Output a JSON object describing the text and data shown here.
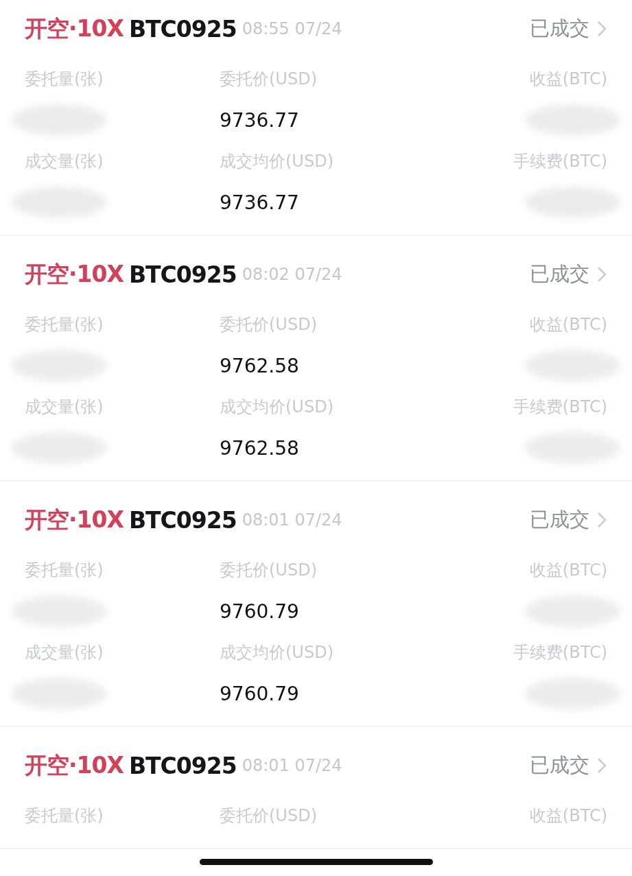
{
  "orders": [
    {
      "side": "开空·10X",
      "symbol": "BTC0925",
      "time": "08:55 07/24",
      "status": "已成交",
      "fields": [
        {
          "label": "委托量(张)",
          "kind": "redacted"
        },
        {
          "label": "委托价(USD)",
          "kind": "value",
          "value": "9736.77"
        },
        {
          "label": "收益(BTC)",
          "kind": "redacted"
        },
        {
          "label": "成交量(张)",
          "kind": "redacted"
        },
        {
          "label": "成交均价(USD)",
          "kind": "value",
          "value": "9736.77"
        },
        {
          "label": "手续费(BTC)",
          "kind": "redacted"
        }
      ]
    },
    {
      "side": "开空·10X",
      "symbol": "BTC0925",
      "time": "08:02 07/24",
      "status": "已成交",
      "fields": [
        {
          "label": "委托量(张)",
          "kind": "redacted"
        },
        {
          "label": "委托价(USD)",
          "kind": "value",
          "value": "9762.58"
        },
        {
          "label": "收益(BTC)",
          "kind": "redacted"
        },
        {
          "label": "成交量(张)",
          "kind": "redacted"
        },
        {
          "label": "成交均价(USD)",
          "kind": "value",
          "value": "9762.58"
        },
        {
          "label": "手续费(BTC)",
          "kind": "redacted"
        }
      ]
    },
    {
      "side": "开空·10X",
      "symbol": "BTC0925",
      "time": "08:01 07/24",
      "status": "已成交",
      "fields": [
        {
          "label": "委托量(张)",
          "kind": "redacted"
        },
        {
          "label": "委托价(USD)",
          "kind": "value",
          "value": "9760.79"
        },
        {
          "label": "收益(BTC)",
          "kind": "redacted"
        },
        {
          "label": "成交量(张)",
          "kind": "redacted"
        },
        {
          "label": "成交均价(USD)",
          "kind": "value",
          "value": "9760.79"
        },
        {
          "label": "手续费(BTC)",
          "kind": "redacted"
        }
      ]
    },
    {
      "side": "开空·10X",
      "symbol": "BTC0925",
      "time": "08:01 07/24",
      "status": "已成交",
      "fields": [
        {
          "label": "委托量(张)"
        },
        {
          "label": "委托价(USD)"
        },
        {
          "label": "收益(BTC)"
        }
      ]
    }
  ]
}
